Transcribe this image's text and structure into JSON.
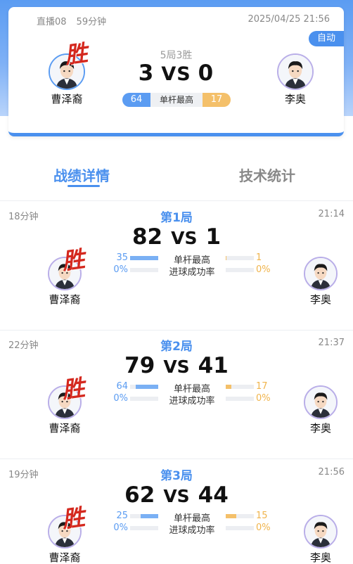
{
  "header": {
    "channel": "直播08",
    "duration": "59分钟",
    "datetime": "2025/04/25 21:56",
    "auto_label": "自动",
    "format": "5局3胜",
    "score_left": "3",
    "vs": "VS",
    "score_right": "0",
    "high_break_label": "单杆最高",
    "high_break_left": "64",
    "high_break_right": "17",
    "win_mark": "胜",
    "player_left": "曹泽裔",
    "player_right": "李奥"
  },
  "tabs": {
    "details": "战绩详情",
    "stats": "技术统计"
  },
  "stat_labels": {
    "high_break": "单杆最高",
    "pot_rate": "进球成功率"
  },
  "games": [
    {
      "duration": "18分钟",
      "title": "第1局",
      "time": "21:14",
      "score_left": "82",
      "vs": "VS",
      "score_right": "1",
      "high_left": "35",
      "high_right": "1",
      "pot_left": "0%",
      "pot_right": "0%",
      "high_left_frac": 1.0,
      "high_right_frac": 0.03,
      "win_mark": "胜",
      "player_left": "曹泽裔",
      "player_right": "李奥"
    },
    {
      "duration": "22分钟",
      "title": "第2局",
      "time": "21:37",
      "score_left": "79",
      "vs": "VS",
      "score_right": "41",
      "high_left": "64",
      "high_right": "17",
      "pot_left": "0%",
      "pot_right": "0%",
      "high_left_frac": 0.79,
      "high_right_frac": 0.21,
      "win_mark": "胜",
      "player_left": "曹泽裔",
      "player_right": "李奥"
    },
    {
      "duration": "19分钟",
      "title": "第3局",
      "time": "21:56",
      "score_left": "62",
      "vs": "VS",
      "score_right": "44",
      "high_left": "25",
      "high_right": "15",
      "pot_left": "0%",
      "pot_right": "0%",
      "high_left_frac": 0.62,
      "high_right_frac": 0.38,
      "win_mark": "胜",
      "player_left": "曹泽裔",
      "player_right": "李奥"
    }
  ],
  "colors": {
    "accent": "#4a90ee",
    "left_player": "#5b9cf2",
    "right_player": "#f0b44c",
    "win": "#d4281e"
  }
}
